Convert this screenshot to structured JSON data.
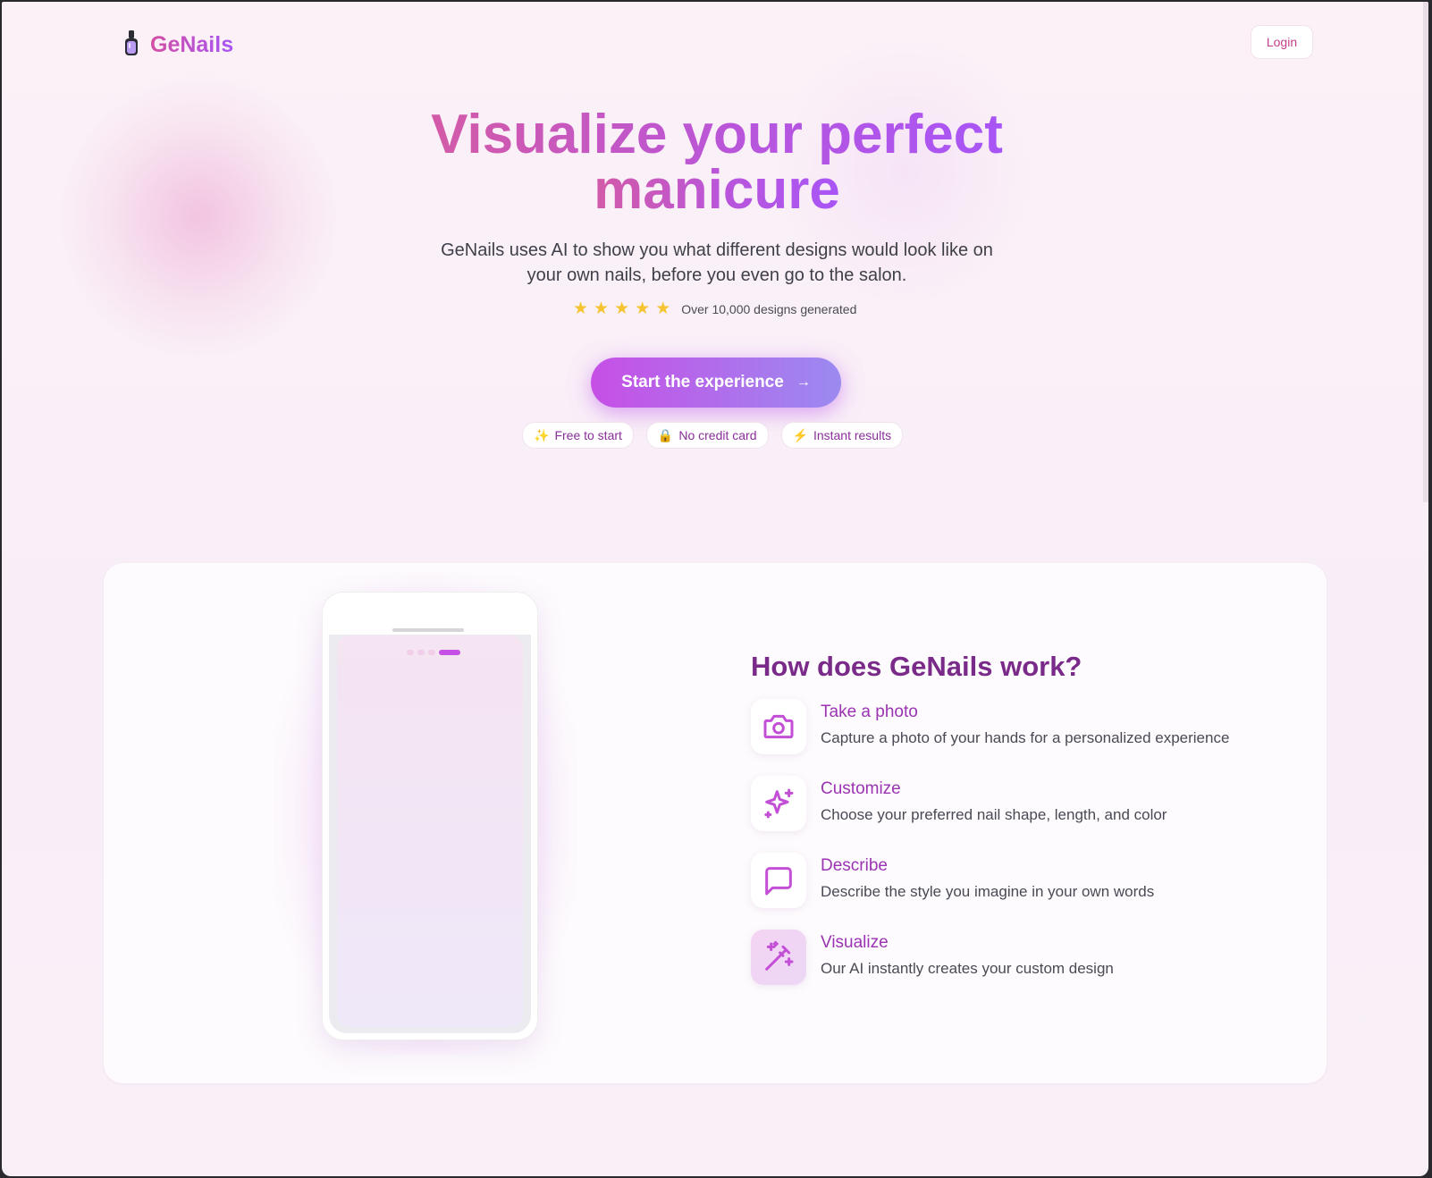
{
  "header": {
    "logo_text": "GeNails",
    "logo_icon": "nail-polish-bottle-icon",
    "login_label": "Login"
  },
  "hero": {
    "title_line1": "Visualize your perfect",
    "title_line2": "manicure",
    "subtitle_line1": "GeNails uses AI to show you what different designs would look like on",
    "subtitle_line2": "your own nails, before you even go to the salon.",
    "rating_stars": 5,
    "rating_text": "Over 10,000 designs generated",
    "cta_label": "Start the experience",
    "cta_arrow": "→",
    "pills": [
      {
        "icon": "✨",
        "label": "Free to start"
      },
      {
        "icon": "🔒",
        "label": "No credit card"
      },
      {
        "icon": "⚡",
        "label": "Instant results"
      }
    ]
  },
  "how": {
    "title": "How does GeNails work?",
    "phone_progress": {
      "active_step": 4,
      "total_steps": 4
    },
    "steps": [
      {
        "icon": "camera-icon",
        "title": "Take a photo",
        "desc": "Capture a photo of your hands for a personalized experience"
      },
      {
        "icon": "sparkles-icon",
        "title": "Customize",
        "desc": "Choose your preferred nail shape, length, and color"
      },
      {
        "icon": "message-square-icon",
        "title": "Describe",
        "desc": "Describe the style you imagine in your own words"
      },
      {
        "icon": "magic-wand-icon",
        "title": "Visualize",
        "desc": "Our AI instantly creates your custom design"
      }
    ]
  },
  "colors": {
    "brand_pink": "#d34fa2",
    "brand_purple": "#a855f7",
    "heading_purple": "#7a2a88",
    "star_yellow": "#f5c430"
  }
}
